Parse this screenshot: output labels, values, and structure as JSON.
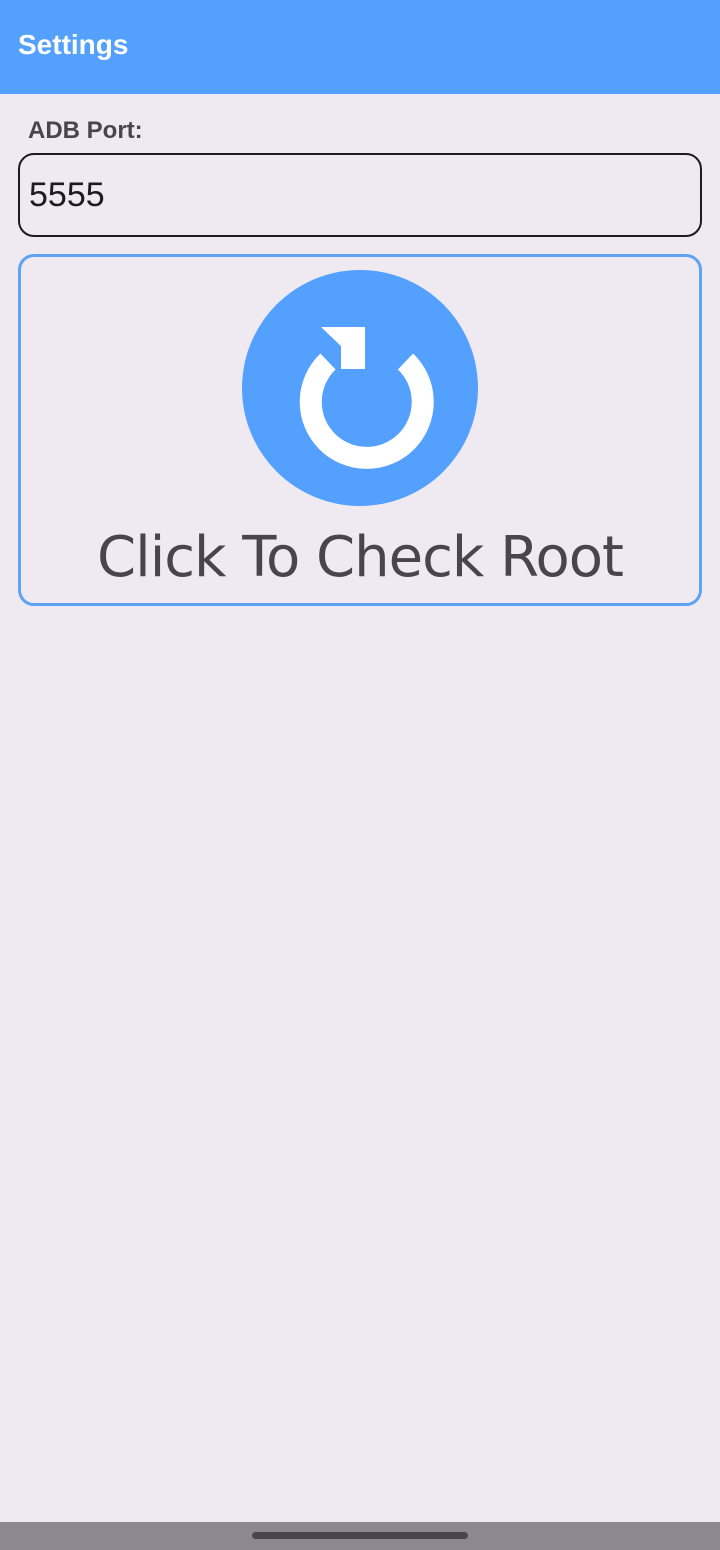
{
  "app_bar": {
    "title": "Settings",
    "color": "#54A0FE"
  },
  "adb_port": {
    "label": "ADB Port:",
    "value": "5555"
  },
  "root_check": {
    "icon": "refresh-icon",
    "label": "Click To Check Root",
    "accent_color": "#54A0FE"
  }
}
